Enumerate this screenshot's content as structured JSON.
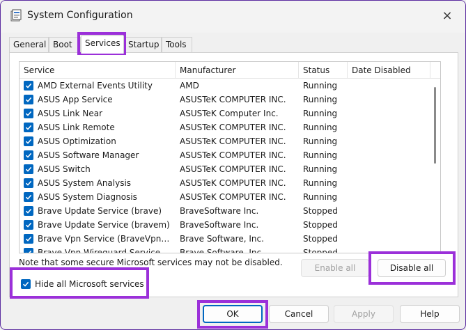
{
  "window": {
    "title": "System Configuration",
    "icon": "system-config-icon",
    "close": "×"
  },
  "tabs": [
    {
      "label": "General"
    },
    {
      "label": "Boot"
    },
    {
      "label": "Services",
      "active": true
    },
    {
      "label": "Startup"
    },
    {
      "label": "Tools"
    }
  ],
  "columns": [
    "Service",
    "Manufacturer",
    "Status",
    "Date Disabled"
  ],
  "services": [
    {
      "service": "AMD External Events Utility",
      "manufacturer": "AMD",
      "status": "Running",
      "checked": true
    },
    {
      "service": "ASUS App Service",
      "manufacturer": "ASUSTeK COMPUTER INC.",
      "status": "Running",
      "checked": true
    },
    {
      "service": "ASUS Link Near",
      "manufacturer": "ASUSTeK Computer Inc.",
      "status": "Running",
      "checked": true
    },
    {
      "service": "ASUS Link Remote",
      "manufacturer": "ASUSTeK COMPUTER INC.",
      "status": "Running",
      "checked": true
    },
    {
      "service": "ASUS Optimization",
      "manufacturer": "ASUSTeK COMPUTER INC.",
      "status": "Running",
      "checked": true
    },
    {
      "service": "ASUS Software Manager",
      "manufacturer": "ASUSTeK COMPUTER INC.",
      "status": "Running",
      "checked": true
    },
    {
      "service": "ASUS Switch",
      "manufacturer": "ASUSTeK COMPUTER INC.",
      "status": "Running",
      "checked": true
    },
    {
      "service": "ASUS System Analysis",
      "manufacturer": "ASUSTeK COMPUTER INC.",
      "status": "Running",
      "checked": true
    },
    {
      "service": "ASUS System Diagnosis",
      "manufacturer": "ASUSTeK COMPUTER INC.",
      "status": "Running",
      "checked": true
    },
    {
      "service": "Brave Update Service (brave)",
      "manufacturer": "BraveSoftware Inc.",
      "status": "Stopped",
      "checked": true
    },
    {
      "service": "Brave Update Service (bravem)",
      "manufacturer": "BraveSoftware Inc.",
      "status": "Stopped",
      "checked": true
    },
    {
      "service": "Brave Vpn Service (BraveVpnSe...",
      "manufacturer": "Brave Software, Inc.",
      "status": "Stopped",
      "checked": true
    },
    {
      "service": "Brave Vpn Wireguard Service (B...",
      "manufacturer": "Brave Software, Inc.",
      "status": "Stopped",
      "checked": true
    }
  ],
  "note": "Note that some secure Microsoft services may not be disabled.",
  "buttons": {
    "enable_all": "Enable all",
    "disable_all": "Disable all",
    "ok": "OK",
    "cancel": "Cancel",
    "apply": "Apply",
    "help": "Help"
  },
  "hide_ms": {
    "label": "Hide all Microsoft services",
    "checked": true
  },
  "colors": {
    "highlight": "#9b30d9",
    "accent": "#0067c0"
  }
}
